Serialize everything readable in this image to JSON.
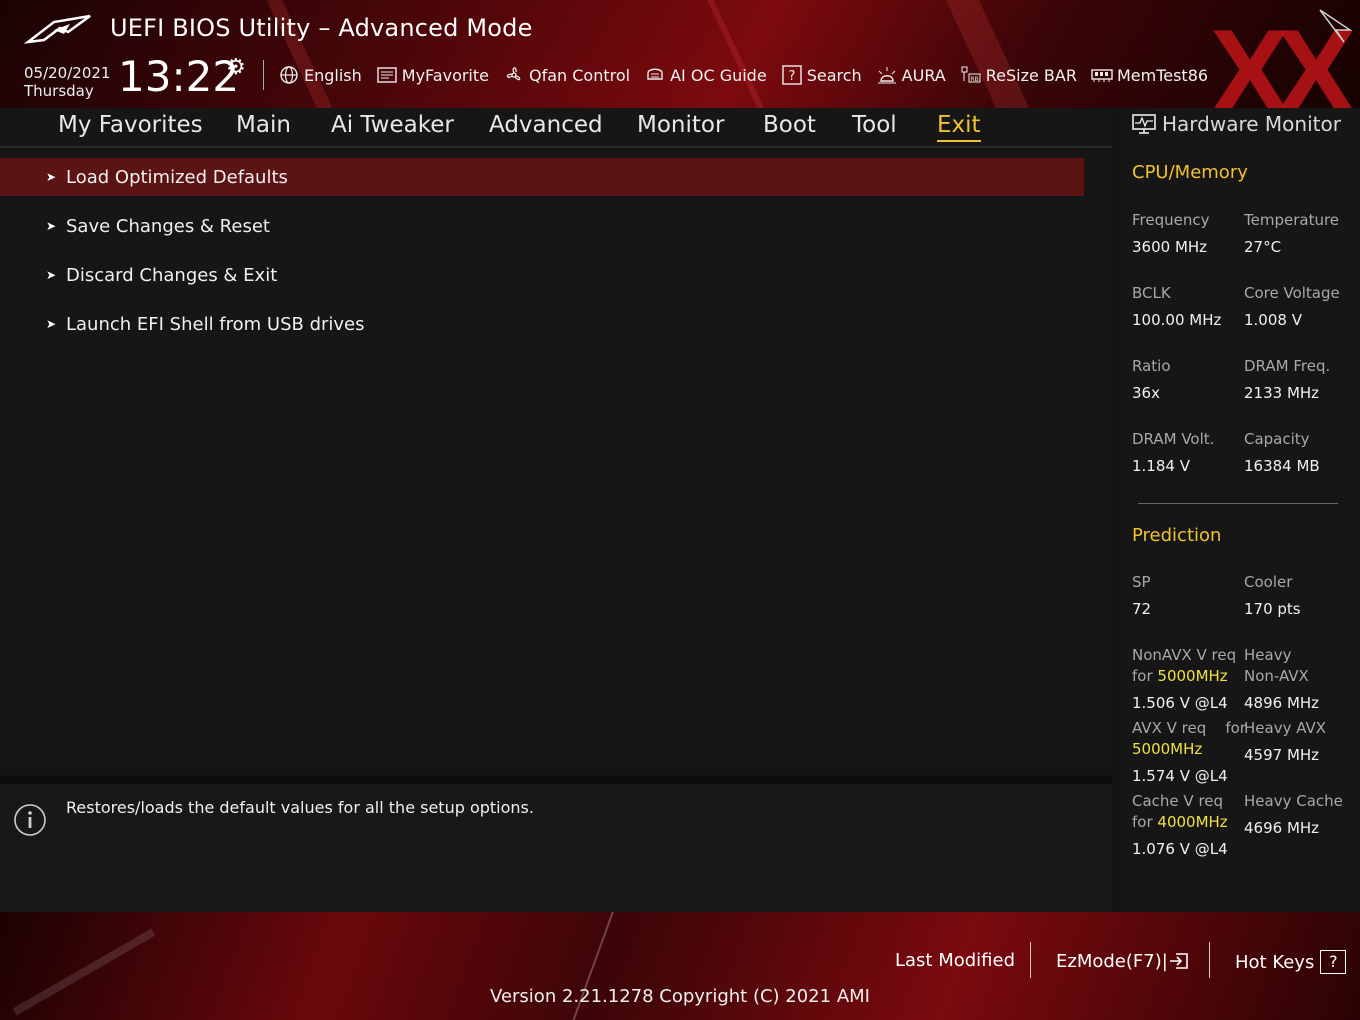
{
  "header": {
    "title": "UEFI BIOS Utility – Advanced Mode",
    "date": "05/20/2021",
    "day": "Thursday",
    "time": "13:22",
    "toolbar": [
      {
        "label": "English",
        "icon": "globe-icon"
      },
      {
        "label": "MyFavorite",
        "icon": "favorite-list-icon"
      },
      {
        "label": "Qfan Control",
        "icon": "fan-icon"
      },
      {
        "label": "AI OC Guide",
        "icon": "ai-chip-icon"
      },
      {
        "label": "Search",
        "icon": "help-search-icon"
      },
      {
        "label": "AURA",
        "icon": "aura-light-icon"
      },
      {
        "label": "ReSize BAR",
        "icon": "resize-bar-icon"
      },
      {
        "label": "MemTest86",
        "icon": "memory-icon"
      }
    ],
    "watermark": "XX"
  },
  "menu": {
    "tabs": [
      "My Favorites",
      "Main",
      "Ai Tweaker",
      "Advanced",
      "Monitor",
      "Boot",
      "Tool",
      "Exit"
    ],
    "active": "Exit"
  },
  "items": [
    {
      "label": "Load Optimized Defaults",
      "selected": true
    },
    {
      "label": "Save Changes & Reset",
      "selected": false
    },
    {
      "label": "Discard Changes & Exit",
      "selected": false
    },
    {
      "label": "Launch EFI Shell from USB drives",
      "selected": false
    }
  ],
  "help": {
    "text": "Restores/loads the default values for all the setup options."
  },
  "hw_monitor": {
    "title": "Hardware Monitor",
    "cpu_section": "CPU/Memory",
    "cpu_rows": [
      {
        "l_label": "Frequency",
        "l_value": "3600 MHz",
        "r_label": "Temperature",
        "r_value": "27°C"
      },
      {
        "l_label": "BCLK",
        "l_value": "100.00 MHz",
        "r_label": "Core Voltage",
        "r_value": "1.008 V"
      },
      {
        "l_label": "Ratio",
        "l_value": "36x",
        "r_label": "DRAM Freq.",
        "r_value": "2133 MHz"
      },
      {
        "l_label": "DRAM Volt.",
        "l_value": "1.184 V",
        "r_label": "Capacity",
        "r_value": "16384 MB"
      }
    ],
    "pred_section": "Prediction",
    "sp_label": "SP",
    "sp_value": "72",
    "cooler_label": "Cooler",
    "cooler_value": "170 pts",
    "nonavx_label_a": "NonAVX V req",
    "nonavx_label_b": "for",
    "nonavx_freq": "5000MHz",
    "nonavx_value": "1.506 V @L4",
    "heavy_nonavx_label_a": "Heavy",
    "heavy_nonavx_label_b": "Non-AVX",
    "heavy_nonavx_value": "4896 MHz",
    "avx_label_a": "AVX V req",
    "avx_label_for": "for",
    "avx_freq": "5000MHz",
    "avx_value": "1.574 V @L4",
    "heavy_avx_label": "Heavy AVX",
    "heavy_avx_value": "4597 MHz",
    "cache_label_a": "Cache V req",
    "cache_label_b": "for",
    "cache_freq": "4000MHz",
    "cache_value": "1.076 V @L4",
    "heavy_cache_label": "Heavy Cache",
    "heavy_cache_value": "4696 MHz"
  },
  "footer": {
    "last_modified": "Last Modified",
    "ezmode": "EzMode(F7)|",
    "hotkeys": "Hot Keys",
    "hotkeys_key": "?",
    "version": "Version 2.21.1278 Copyright (C) 2021 AMI"
  },
  "colors": {
    "accent": "#f0c230",
    "highlight": "#f0e040",
    "selected_row": "#5c1314",
    "brand_red": "#7c0a0e"
  }
}
